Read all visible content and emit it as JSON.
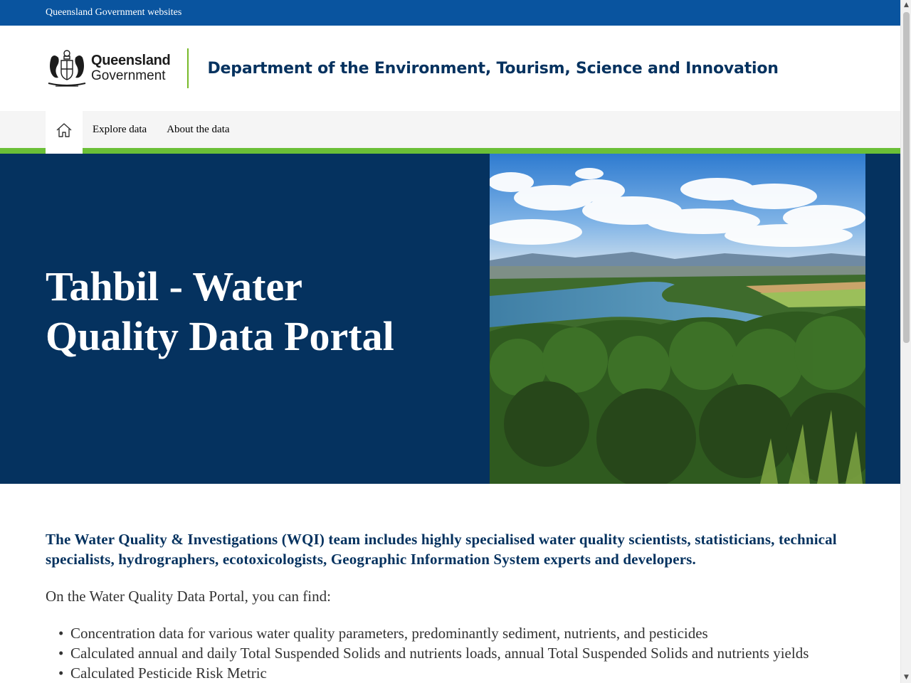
{
  "gov_bar": {
    "label": "Queensland Government websites"
  },
  "header": {
    "logo_line1": "Queensland",
    "logo_line2": "Government",
    "department": "Department of the Environment, Tourism, Science and Innovation"
  },
  "nav": {
    "home_icon": "home-icon",
    "items": [
      {
        "label": "Explore data"
      },
      {
        "label": "About the data"
      }
    ]
  },
  "hero": {
    "title": "Tahbil - Water Quality Data Portal",
    "background_color": "#05325f",
    "image": "river-landscape-photo"
  },
  "content": {
    "lead": "The Water Quality & Investigations (WQI) team includes highly specialised water quality scientists, statisticians, technical specialists, hydrographers, ecotoxicologists, Geographic Information System experts and developers.",
    "intro": "On the Water Quality Data Portal, you can find:",
    "list": [
      "Concentration data for various water quality parameters, predominantly sediment, nutrients, and pesticides",
      "Calculated annual and daily Total Suspended Solids and nutrients loads, annual Total Suspended Solids and nutrients yields",
      "Calculated Pesticide Risk Metric"
    ]
  },
  "colors": {
    "gov_bar": "#09549f",
    "navy": "#05325f",
    "accent_green": "#6bbf37"
  }
}
